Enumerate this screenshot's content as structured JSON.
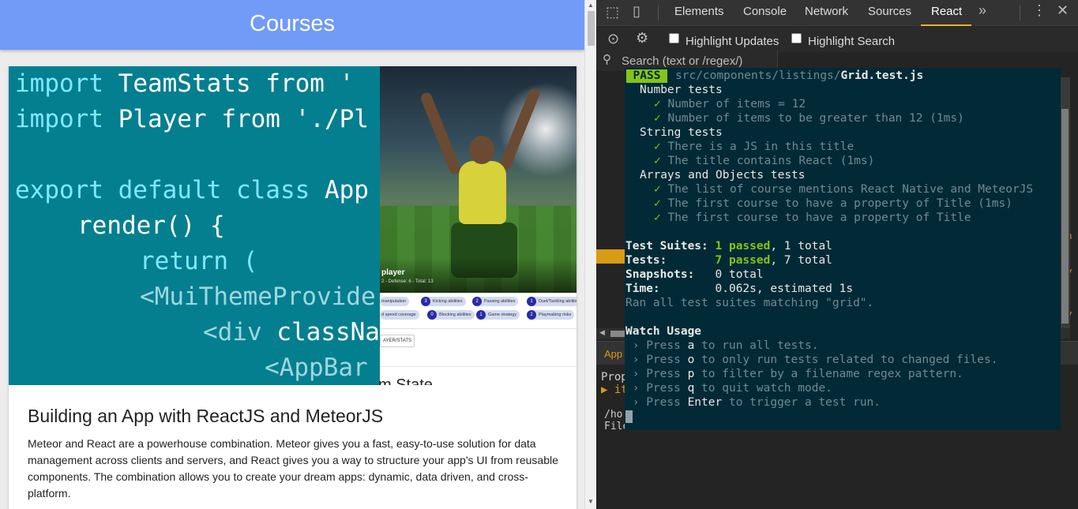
{
  "app": {
    "title": "Courses"
  },
  "card": {
    "code_lines": [
      {
        "parts": [
          {
            "t": "import ",
            "c": "kw"
          },
          {
            "t": "TeamStats ",
            "c": "wt"
          },
          {
            "t": "from '",
            "c": "wt"
          }
        ]
      },
      {
        "parts": [
          {
            "t": "import ",
            "c": "kw"
          },
          {
            "t": "Player ",
            "c": "wt"
          },
          {
            "t": "from './Pl",
            "c": "wt"
          }
        ]
      },
      {
        "parts": [
          {
            "t": "export default class ",
            "c": "kw"
          },
          {
            "t": "App",
            "c": "wt"
          }
        ]
      },
      {
        "parts": [
          {
            "t": "render() {",
            "c": "wt"
          }
        ]
      },
      {
        "parts": [
          {
            "t": "return (",
            "c": "kw"
          }
        ]
      },
      {
        "parts": [
          {
            "t": "<MuiThemeProvide",
            "c": "dim"
          }
        ]
      },
      {
        "parts": [
          {
            "t": "<div ",
            "c": "dim"
          },
          {
            "t": "classNa",
            "c": "wt"
          }
        ]
      },
      {
        "parts": [
          {
            "t": "<AppBar",
            "c": "dim"
          }
        ]
      }
    ],
    "player_name": "player",
    "player_stats": "2 - Defense: 6 - Total: 13",
    "chips_row1": [
      {
        "num": "",
        "label": "manipulation"
      },
      {
        "num": "3",
        "label": "Kicking abilities"
      },
      {
        "num": "2",
        "label": "Passing abilities"
      },
      {
        "num": "1",
        "label": "Duel/Tackling abilities"
      }
    ],
    "chips_row2": [
      {
        "num": "",
        "label": "d speed coverage"
      },
      {
        "num": "0",
        "label": "Blocking abilities"
      },
      {
        "num": "1",
        "label": "Game strategy"
      },
      {
        "num": "2",
        "label": "Playmaking risks"
      }
    ],
    "player_stats_button": "AYER/STATS",
    "team_state_heading": "m State",
    "title": "Building an App with ReactJS and MeteorJS",
    "description": "Meteor and React are a powerhouse combination. Meteor gives you a fast, easy-to-use solution for data management across clients and servers, and React gives you a way to structure your app's UI from reusable components. The combination allows you to create your dream apps: dynamic, data driven, and cross-platform."
  },
  "devtools": {
    "tabs": [
      "Elements",
      "Console",
      "Network",
      "Sources",
      "React"
    ],
    "active_tab": "React",
    "overflow_icon": "chevron-double-right",
    "highlight_updates_label": "Highlight Updates",
    "highlight_search_label": "Highlight Search",
    "search_placeholder": "Search (text or /regex/)",
    "bottom_tab_label": "App",
    "props_label": "Prop",
    "props_item": "▶ it",
    "bottom_line1": "/ho",
    "bottom_line2": "File",
    "side_glyphs": [
      "an",
      "l",
      ".v",
      "2",
      "2",
      "ry"
    ]
  },
  "terminal": {
    "pass_label": "PASS",
    "test_path_dim": "src/components/listings/",
    "test_file": "Grid.test.js",
    "groups": [
      {
        "name": "Number tests",
        "tests": [
          "Number of items = 12",
          "Number of items to be greater than 12 (1ms)"
        ]
      },
      {
        "name": "String tests",
        "tests": [
          "There is a JS in this title",
          "The title contains React (1ms)"
        ]
      },
      {
        "name": "Arrays and Objects tests",
        "tests": [
          "The list of course mentions React Native and MeteorJS",
          "The first course to have a property of Title (1ms)",
          "The first course to have a property of Title"
        ]
      }
    ],
    "check": "✓",
    "summary": {
      "suites_label": "Test Suites:",
      "suites_passed": "1 passed",
      "suites_total": ", 1 total",
      "tests_label": "Tests:",
      "tests_passed": "7 passed",
      "tests_total": ", 7 total",
      "snapshots_label": "Snapshots:",
      "snapshots_value": "0 total",
      "time_label": "Time:",
      "time_value": "0.062s, estimated 1s",
      "ran_all": "Ran all test suites matching \"grid\"."
    },
    "watch_title": "Watch Usage",
    "watch_items": [
      {
        "pre": "› Press ",
        "key": "a",
        "post": " to run all tests."
      },
      {
        "pre": "› Press ",
        "key": "o",
        "post": " to only run tests related to changed files."
      },
      {
        "pre": "› Press ",
        "key": "p",
        "post": " to filter by a filename regex pattern."
      },
      {
        "pre": "› Press ",
        "key": "q",
        "post": " to quit watch mode."
      },
      {
        "pre": "› Press ",
        "key": "Enter",
        "post": " to trigger a test run."
      }
    ]
  },
  "colors": {
    "appbar": "#729bf7",
    "code_bg": "#047f90",
    "terminal_bg": "#012a36",
    "pass_green": "#85c418",
    "react_tab_accent": "#f2b21e"
  }
}
